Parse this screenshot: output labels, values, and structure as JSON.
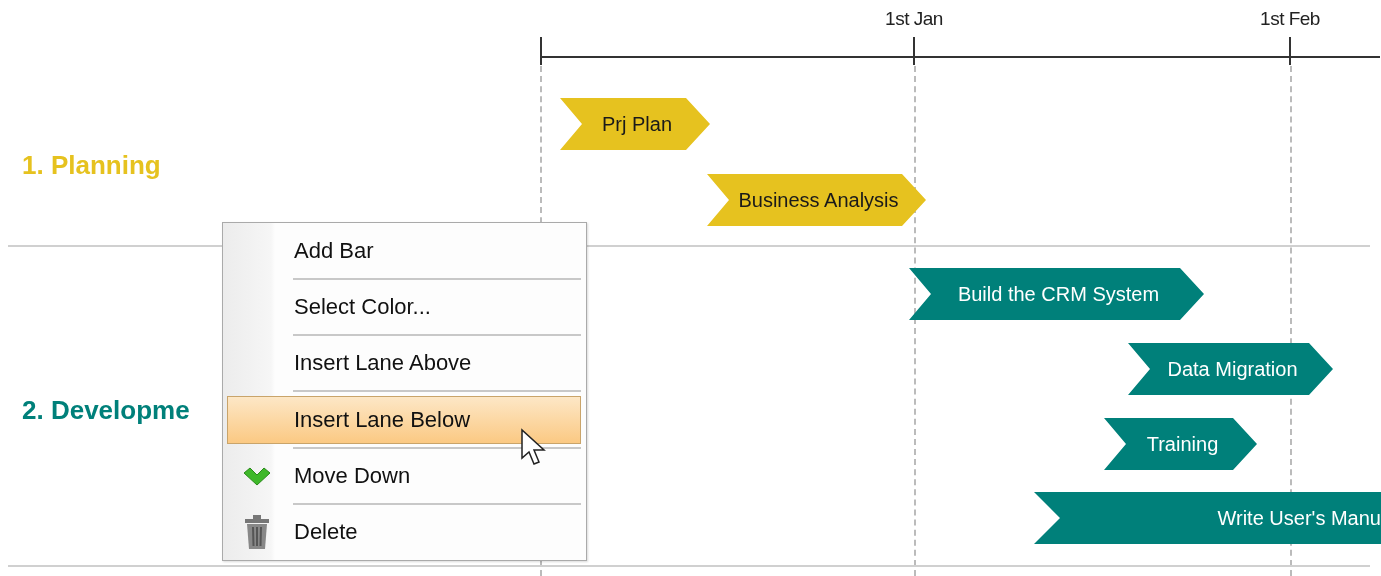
{
  "timeline": {
    "ticks": [
      "1st Jan",
      "1st Feb"
    ]
  },
  "lanes": [
    {
      "label": "1. Planning",
      "color": "#e6c21f",
      "bars": [
        {
          "label": "Prj Plan"
        },
        {
          "label": "Business Analysis"
        }
      ]
    },
    {
      "label": "2. Developme",
      "color": "#00807a",
      "bars": [
        {
          "label": "Build the CRM System"
        },
        {
          "label": "Data Migration"
        },
        {
          "label": "Training"
        },
        {
          "label": "Write User's Manu"
        }
      ]
    }
  ],
  "context_menu": {
    "items": [
      {
        "label": "Add Bar",
        "kind": "plain",
        "selected": false
      },
      {
        "label": "Select Color...",
        "kind": "plain",
        "selected": false
      },
      {
        "label": "Insert Lane Above",
        "kind": "plain",
        "selected": false
      },
      {
        "label": "Insert Lane Below",
        "kind": "plain",
        "selected": true
      },
      {
        "label": "Move Down",
        "kind": "move",
        "selected": false
      },
      {
        "label": "Delete",
        "kind": "delete",
        "selected": false
      }
    ]
  }
}
